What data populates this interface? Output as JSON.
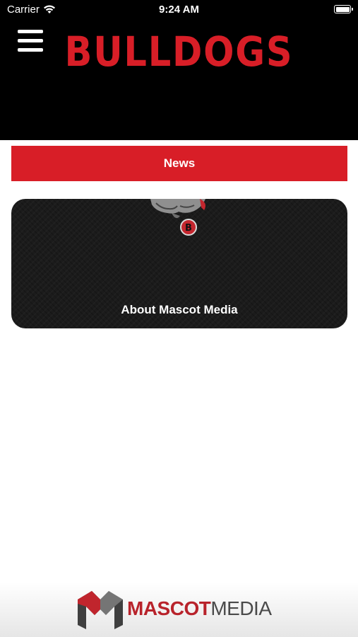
{
  "status_bar": {
    "carrier": "Carrier",
    "time": "9:24 AM",
    "icons": [
      "wifi-icon",
      "battery-icon"
    ]
  },
  "header": {
    "title": "BULLDOGS",
    "menu_icon": "hamburger-menu-icon",
    "title_color": "#d81e27",
    "background": "#000000"
  },
  "nav": {
    "news_label": "News",
    "accent": "#d81e27"
  },
  "cards": [
    {
      "label": "About Mascot Media",
      "image": "bulldog-mascot"
    }
  ],
  "footer": {
    "logo_part1": "MASCOT",
    "logo_part2": "MEDIA",
    "logo_icon": "mascot-media-m-logo",
    "colors": {
      "red": "#b8232b",
      "gray": "#4a4a4a"
    }
  }
}
